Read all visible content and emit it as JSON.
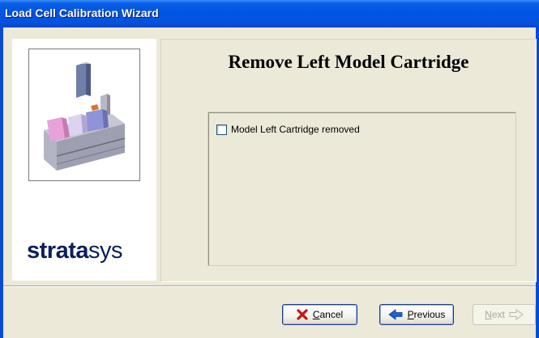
{
  "window": {
    "title": "Load Cell Calibration Wizard"
  },
  "sidebar": {
    "logo_bold": "strata",
    "logo_light": "sys",
    "image_icon": "printer-assembly-illustration"
  },
  "page": {
    "heading": "Remove Left Model Cartridge",
    "checkbox": {
      "label": "Model Left Cartridge removed",
      "checked": false
    }
  },
  "buttons": {
    "cancel": {
      "label": "Cancel",
      "icon": "red-x-icon"
    },
    "previous": {
      "label": "Previous",
      "icon": "left-arrow-icon"
    },
    "next": {
      "label": "Next",
      "icon": "right-arrow-outline-icon",
      "enabled": false
    }
  },
  "colors": {
    "titlebar": "#0054e3",
    "window_bg": "#ece9d8",
    "logo": "#0b1f5c",
    "accent_blue": "#1b62d8",
    "cancel_red": "#c51616"
  }
}
